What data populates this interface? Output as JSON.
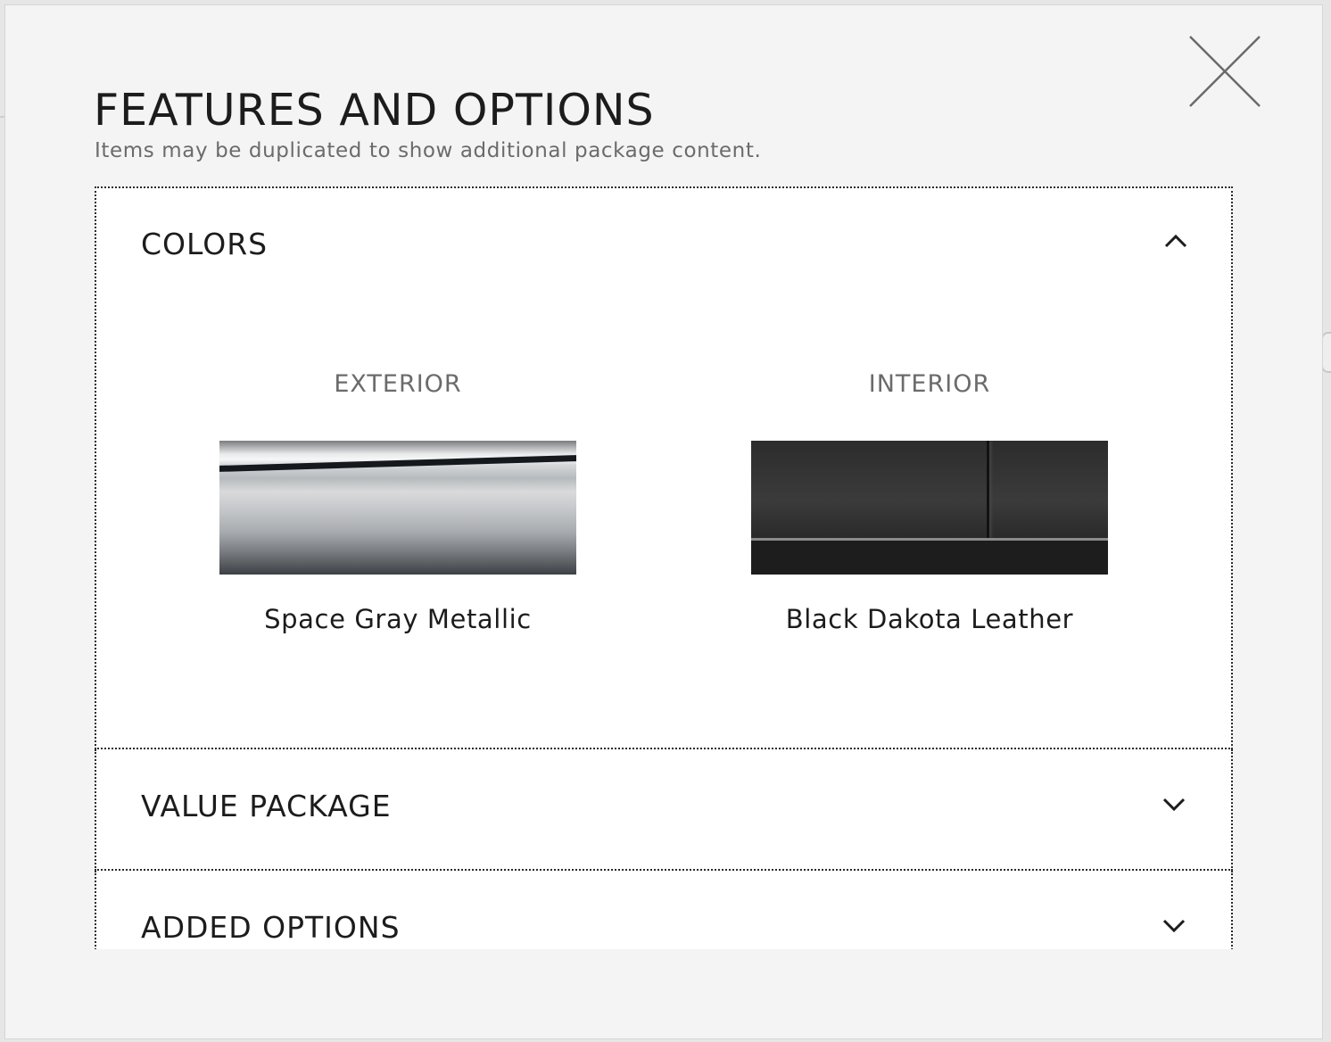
{
  "modal": {
    "title": "FEATURES AND OPTIONS",
    "subtitle": "Items may be duplicated to show additional package content."
  },
  "sections": {
    "colors": {
      "label": "COLORS",
      "expanded": true,
      "exterior": {
        "heading": "EXTERIOR",
        "name": "Space Gray Metallic"
      },
      "interior": {
        "heading": "INTERIOR",
        "name": "Black Dakota Leather"
      }
    },
    "value_package": {
      "label": "VALUE PACKAGE",
      "expanded": false
    },
    "added_options": {
      "label": "ADDED OPTIONS",
      "expanded": false
    }
  },
  "icons": {
    "close": "close-icon",
    "collapse": "chevron-up-icon",
    "expand": "chevron-down-icon"
  }
}
